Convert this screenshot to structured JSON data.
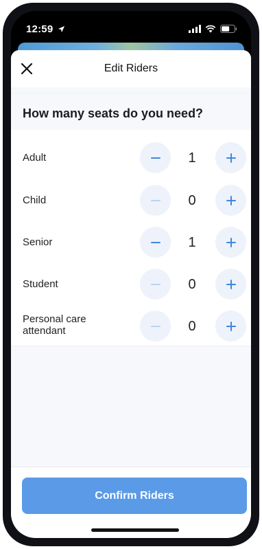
{
  "status_bar": {
    "time": "12:59"
  },
  "header": {
    "title": "Edit Riders"
  },
  "question": "How many seats do you need?",
  "riders": [
    {
      "label": "Adult",
      "count": "1",
      "minus_enabled": true
    },
    {
      "label": "Child",
      "count": "0",
      "minus_enabled": false
    },
    {
      "label": "Senior",
      "count": "1",
      "minus_enabled": true
    },
    {
      "label": "Student",
      "count": "0",
      "minus_enabled": false
    },
    {
      "label": "Personal care attendant",
      "count": "0",
      "minus_enabled": false
    }
  ],
  "footer": {
    "confirm_label": "Confirm Riders"
  },
  "colors": {
    "accent": "#3f86dd",
    "accent_disabled": "#bcd3f0",
    "button_bg": "#5b9ae6",
    "stepper_bg": "#eef2fa"
  }
}
